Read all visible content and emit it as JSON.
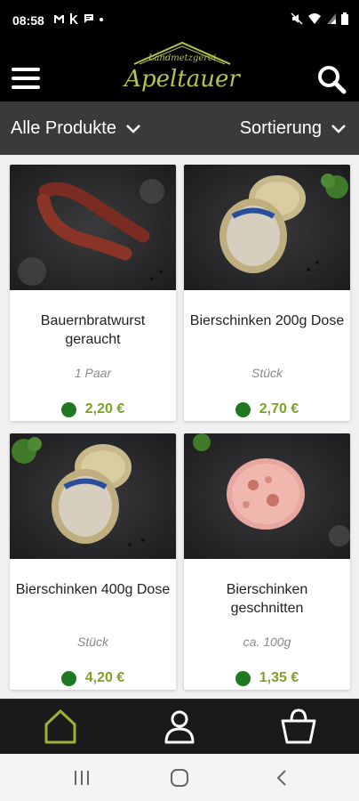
{
  "status_bar": {
    "time": "08:58",
    "left_icons": [
      "gmail-icon",
      "k-app-icon",
      "message-icon",
      "dot-icon"
    ],
    "right_icons": [
      "mute-icon",
      "wifi-icon",
      "signal-icon",
      "battery-icon"
    ]
  },
  "header": {
    "logo_small": "Landmetzgerei",
    "logo_big": "Apeltauer",
    "logo_color": "#b7c24a"
  },
  "filter": {
    "left_label": "Alle Produkte",
    "right_label": "Sortierung"
  },
  "products": [
    {
      "name": "Bauernbratwurst geraucht",
      "unit": "1 Paar",
      "price": "2,20 €",
      "image": "sausage-image"
    },
    {
      "name": "Bierschinken 200g Dose",
      "unit": "Stück",
      "price": "2,70 €",
      "image": "tin-can-image"
    },
    {
      "name": "Bierschinken 400g Dose",
      "unit": "Stück",
      "price": "4,20 €",
      "image": "tin-can-image"
    },
    {
      "name": "Bierschinken geschnitten",
      "unit": "ca. 100g",
      "price": "1,35 €",
      "image": "ham-slice-image"
    }
  ],
  "colors": {
    "accent": "#7aa327",
    "availability": "#1f7a1f",
    "header_bg": "#000000",
    "filter_bg": "#3a3a3a"
  },
  "bottom_nav": [
    "home-icon",
    "user-icon",
    "basket-icon"
  ],
  "system_nav": [
    "recent-apps-icon",
    "home-circle-icon",
    "back-icon"
  ]
}
